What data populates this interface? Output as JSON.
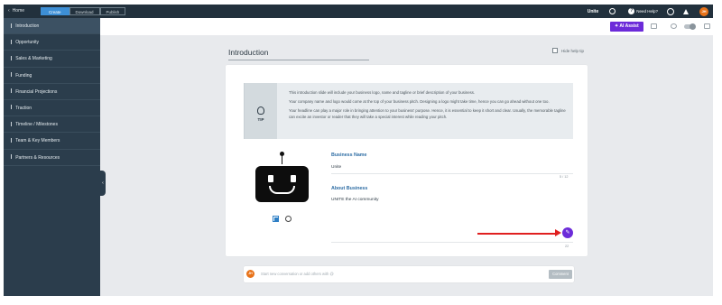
{
  "topbar": {
    "home_label": "Home",
    "tabs": [
      "Create",
      "Download",
      "Publish"
    ],
    "active_tab": "Create",
    "brand": "Unite",
    "help_label": "Need Help?",
    "avatar_initials": "JH"
  },
  "sidebar": {
    "items": [
      {
        "label": "Introduction",
        "active": true
      },
      {
        "label": "Opportunity",
        "active": false
      },
      {
        "label": "Sales & Marketing",
        "active": false
      },
      {
        "label": "Funding",
        "active": false
      },
      {
        "label": "Financial Projections",
        "active": false
      },
      {
        "label": "Traction",
        "active": false
      },
      {
        "label": "Timeline / Milestones",
        "active": false
      },
      {
        "label": "Team & Key Members",
        "active": false
      },
      {
        "label": "Partners & Resources",
        "active": false
      }
    ]
  },
  "subbar": {
    "ai_assist_label": "AI Assist"
  },
  "main": {
    "title": "Introduction",
    "hide_help_label": "Hide help tip",
    "tip": {
      "icon_label": "TIP",
      "paragraphs": [
        "This introduction slide will include your business logo, name and tagline or brief description of your business.",
        "Your company name and logo would come at the top of your business pitch. Designing a logo might take time, hence you can go ahead without one too.",
        "Your headline can play a major role in bringing attention to your business' purpose. Hence, it is essential to keep it short and clear. Usually, the memorable tagline can excite an investor or reader that they will take a special interest while reading your pitch."
      ]
    },
    "business_name": {
      "label": "Business Name",
      "value": "Unite",
      "counter": "5 / 12"
    },
    "about_business": {
      "label": "About Business",
      "value": "UNITE the AI community",
      "counter": "22"
    }
  },
  "conversation": {
    "avatar_initials": "JH",
    "placeholder": "Start new conversation or add others with @",
    "comment_label": "Comment"
  },
  "colors": {
    "topbar_bg": "#22313d",
    "sidebar_bg": "#2b3d4c",
    "accent_blue": "#3d8fd6",
    "ai_purple": "#6c2bd9",
    "arrow_red": "#e02020",
    "avatar_orange": "#e8731a"
  }
}
